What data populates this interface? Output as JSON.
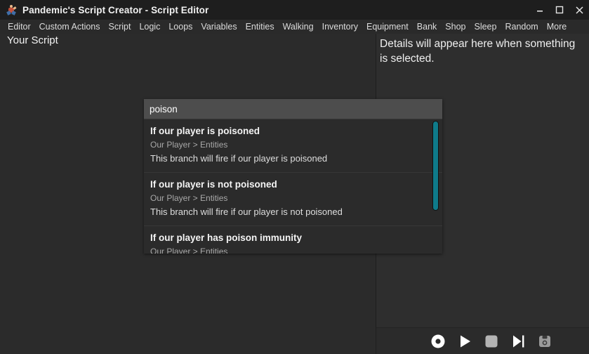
{
  "window": {
    "title": "Pandemic's Script Creator - Script Editor",
    "app_icon": "figure-icon",
    "controls": {
      "minimize": "minimize-icon",
      "maximize": "maximize-icon",
      "close": "close-icon"
    }
  },
  "menubar": {
    "items": [
      {
        "label": "Editor"
      },
      {
        "label": "Custom Actions"
      },
      {
        "label": "Script"
      },
      {
        "label": "Logic"
      },
      {
        "label": "Loops"
      },
      {
        "label": "Variables"
      },
      {
        "label": "Entities"
      },
      {
        "label": "Walking"
      },
      {
        "label": "Inventory"
      },
      {
        "label": "Equipment"
      },
      {
        "label": "Bank"
      },
      {
        "label": "Shop"
      },
      {
        "label": "Sleep"
      },
      {
        "label": "Random"
      },
      {
        "label": "More"
      }
    ]
  },
  "script_pane": {
    "title": "Your Script"
  },
  "details_pane": {
    "placeholder": "Details will appear here when something is selected."
  },
  "autocomplete": {
    "query": "poison",
    "input_placeholder": "",
    "suggestions": [
      {
        "title": "If our player is poisoned",
        "path": "Our Player > Entities",
        "description": "This branch will fire if our player is poisoned"
      },
      {
        "title": "If our player is not poisoned",
        "path": "Our Player > Entities",
        "description": "This branch will fire if our player is not poisoned"
      },
      {
        "title": "If our player has poison immunity",
        "path": "Our Player > Entities",
        "description": ""
      }
    ],
    "scrollbar_color": "#0f7b8a"
  },
  "toolbar": {
    "buttons": [
      {
        "name": "record-icon",
        "label": "Record"
      },
      {
        "name": "play-icon",
        "label": "Play"
      },
      {
        "name": "stop-icon",
        "label": "Stop"
      },
      {
        "name": "step-forward-icon",
        "label": "Step Forward"
      },
      {
        "name": "save-icon",
        "label": "Save"
      }
    ]
  },
  "colors": {
    "window_bg": "#2b2b2b",
    "titlebar_bg": "#1e1e1e",
    "menubar_bg": "#2a2a2a",
    "details_bg": "#2e2e2e",
    "accent": "#0f7b8a",
    "input_bg": "#4d4d4d"
  }
}
